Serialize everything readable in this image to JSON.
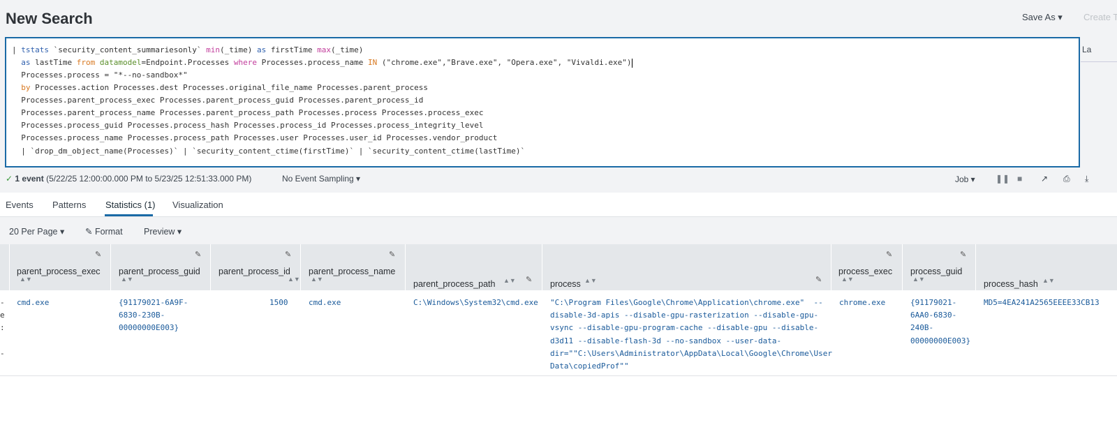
{
  "header": {
    "title": "New Search",
    "save_as": "Save As ▾",
    "create": "Create T"
  },
  "editor": {
    "lines": [
      "| tstats `security_content_summariesonly` min(_time) as firstTime max(_time)",
      "  as lastTime from datamodel=Endpoint.Processes where Processes.process_name IN (\"chrome.exe\",\"Brave.exe\", \"Opera.exe\", \"Vivaldi.exe\")",
      "  Processes.process = \"*--no-sandbox*\"",
      "  by Processes.action Processes.dest Processes.original_file_name Processes.parent_process",
      "  Processes.parent_process_exec Processes.parent_process_guid Processes.parent_process_id",
      "  Processes.parent_process_name Processes.parent_process_path Processes.process Processes.process_exec",
      "  Processes.process_guid Processes.process_hash Processes.process_id Processes.process_integrity_level",
      "  Processes.process_name Processes.process_path Processes.user Processes.user_id Processes.vendor_product",
      "  | `drop_dm_object_name(Processes)` | `security_content_ctime(firstTime)` | `security_content_ctime(lastTime)`"
    ],
    "side_label": "La"
  },
  "status": {
    "count": "1 event",
    "range": "(5/22/25 12:00:00.000 PM to 5/23/25 12:51:33.000 PM)",
    "sampling": "No Event Sampling ▾",
    "job": "Job ▾"
  },
  "tabs": [
    "Events",
    "Patterns",
    "Statistics (1)",
    "Visualization"
  ],
  "toolbar": {
    "per_page": "20 Per Page ▾",
    "format": "Format",
    "preview": "Preview ▾"
  },
  "table": {
    "columns": [
      "parent_process_exec",
      "parent_process_guid",
      "parent_process_id",
      "parent_process_name",
      "parent_process_path",
      "process",
      "process_exec",
      "process_guid",
      "process_hash"
    ],
    "row": {
      "parent_process_exec": "cmd.exe",
      "parent_process_guid": "{91179021-6A9F-\n6830-230B-\n00000000E003}",
      "parent_process_id": "1500",
      "parent_process_name": "cmd.exe",
      "parent_process_path": "C:\\Windows\\System32\\cmd.exe",
      "process": "\"C:\\Program Files\\Google\\Chrome\\Application\\chrome.exe\"  --\ndisable-3d-apis --disable-gpu-rasterization --disable-gpu-\nvsync --disable-gpu-program-cache --disable-gpu --disable-\nd3d11 --disable-flash-3d --no-sandbox --user-data-\ndir=\"\"C:\\Users\\Administrator\\AppData\\Local\\Google\\Chrome\\User\nData\\copiedProf\"\"",
      "process_exec": "chrome.exe",
      "process_guid": "{91179021-\n6AA0-6830-\n240B-\n00000000E003}",
      "process_hash": "MD5=4EA241A2565EEEE33CB13"
    },
    "left_fragment": "-\ne\n:\n\n-"
  }
}
